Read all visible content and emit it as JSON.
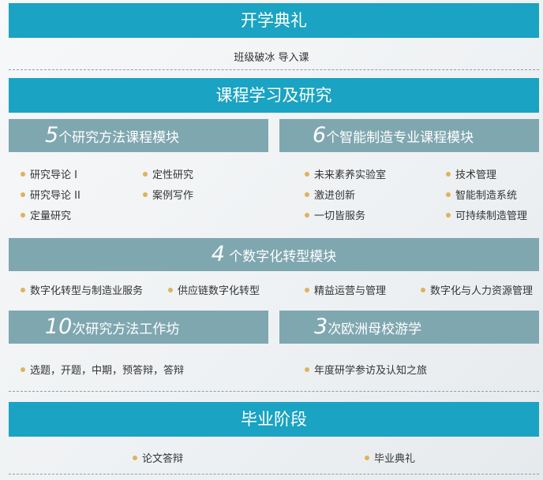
{
  "opening": {
    "title": "开学典礼",
    "subtitle": "班级破冰 导入课"
  },
  "courses": {
    "title": "课程学习及研究",
    "research_modules": {
      "num": "5",
      "label": "个研究方法课程模块",
      "items": [
        "研究导论 I",
        "定性研究",
        "研究导论 II",
        "案例写作",
        "定量研究"
      ]
    },
    "smart_modules": {
      "num": "6",
      "label": "个智能制造专业课程模块",
      "items": [
        "未来素养实验室",
        "技术管理",
        "激进创新",
        "智能制造系统",
        "一切皆服务",
        "可持续制造管理"
      ]
    },
    "digital_modules": {
      "num": "4",
      "label": " 个数字化转型模块",
      "items": [
        "数字化转型与制造业服务",
        "供应链数字化转型",
        "精益运营与管理",
        "数字化与人力资源管理"
      ]
    },
    "workshops": {
      "num": "10",
      "label": "次研究方法工作坊",
      "items": [
        "选题，开题，中期，预答辩，答辩"
      ]
    },
    "study_tours": {
      "num": "3",
      "label": "次欧洲母校游学",
      "items": [
        "年度研学参访及认知之旅"
      ]
    }
  },
  "graduation": {
    "title": "毕业阶段",
    "items": [
      "论文答辩",
      "毕业典礼"
    ]
  },
  "colors": {
    "primary_bar": "#1aa3c2",
    "sub_bar": "#7fa7b0",
    "bullet": "#e0b25a"
  }
}
